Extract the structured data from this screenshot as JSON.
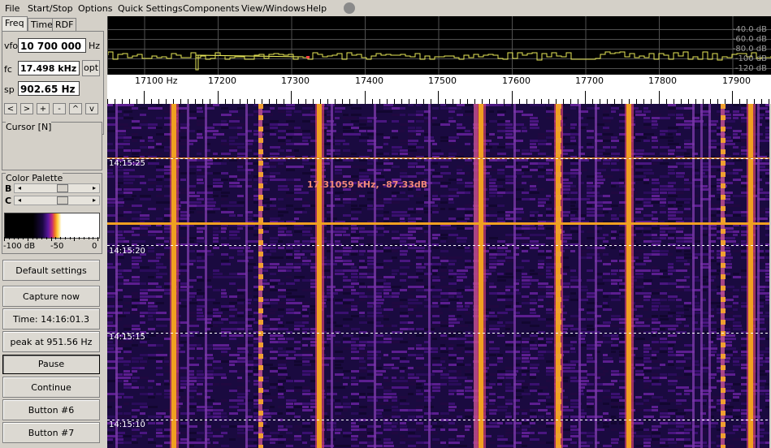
{
  "menu": {
    "file": "File",
    "startstop": "Start/Stop",
    "options": "Options",
    "quick": "Quick Settings",
    "components": "Components",
    "view": "View/Windows",
    "help": "Help"
  },
  "tabs": [
    "Freq",
    "Time",
    "RDF"
  ],
  "freq": {
    "vfo_label": "vfo",
    "vfo_value": "10 700 000",
    "vfo_unit": "Hz",
    "fc_label": "fc",
    "fc_value": "17.498 kHz",
    "opt_label": "opt",
    "sp_label": "sp",
    "sp_value": "902.65 Hz",
    "nav": [
      "<",
      ">",
      "+",
      "-",
      "^",
      "v"
    ]
  },
  "cursor_group": {
    "title": "Cursor [N]"
  },
  "palette_group": {
    "title": "Color Palette",
    "b_label": "B",
    "c_label": "C",
    "scale_left": "-100 dB",
    "scale_mid": "-50",
    "scale_right": "0",
    "b_level": 0.6,
    "c_level": 0.6
  },
  "buttons": {
    "default": "Default settings",
    "capture": "Capture now",
    "time": "Time:  14:16:01.3",
    "peak": "peak at 951.56 Hz",
    "pause": "Pause",
    "continue": "Continue",
    "btn6": "Button #6",
    "btn7": "Button #7"
  },
  "spectrum": {
    "db_labels": [
      "-40.0 dB",
      "-60.0 dB",
      "-80.0 dB",
      "-100 dB",
      "-120 dB"
    ],
    "colors": {
      "trace": "#e8e858",
      "grid": "#505050",
      "marker": "#ff4040"
    }
  },
  "ruler": {
    "labels": [
      "17100 Hz",
      "17200",
      "17300",
      "17400",
      "17500",
      "17600",
      "17700",
      "17800",
      "17900"
    ]
  },
  "waterfall": {
    "time_labels": [
      "14:15:25",
      "14:15:20",
      "14:15:15",
      "14:15:10"
    ],
    "cursor_readout": "17.31059 kHz, -87.33dB",
    "colors": {
      "background": "#1a0a40",
      "line_orange": "#f0a020",
      "line_purple": "#7a3aa8"
    }
  }
}
